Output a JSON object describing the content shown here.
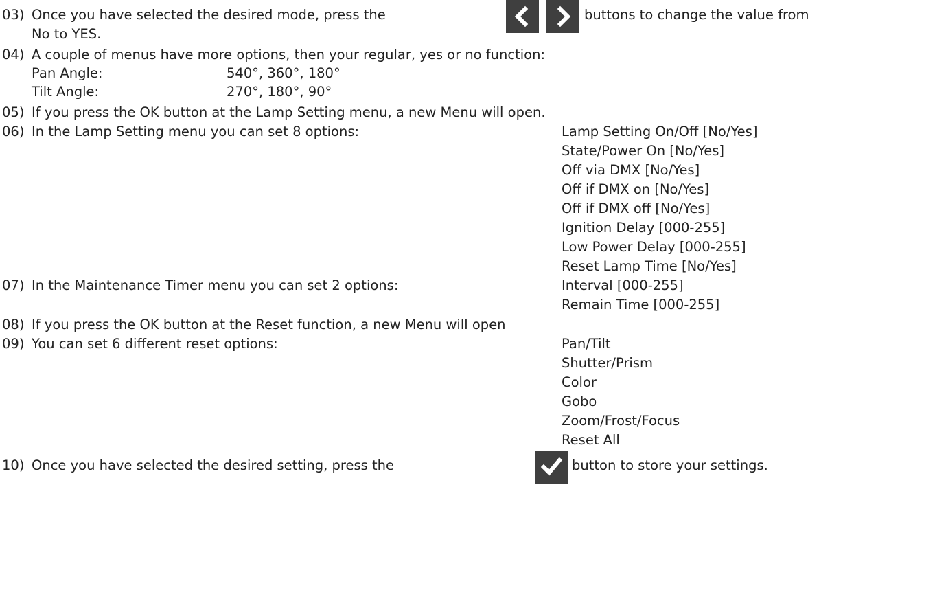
{
  "steps": [
    {
      "num": "03)",
      "text_before": "Once you have selected the desired mode, press the",
      "icons": [
        "chevron-left-icon",
        "chevron-right-icon"
      ],
      "text_after": "buttons to change the value from",
      "continuation": "No to YES."
    },
    {
      "num": "04)",
      "text": "A couple of menus have more options, then your regular, yes or no function:",
      "rows": [
        {
          "label": "Pan Angle:",
          "value": "540°, 360°, 180°"
        },
        {
          "label": "Tilt Angle:",
          "value": "270°, 180°, 90°"
        }
      ]
    },
    {
      "num": "05)",
      "text": "If you press the OK button at the Lamp Setting menu, a new Menu will open."
    },
    {
      "num": "06)",
      "text": "In the Lamp Setting menu you can set 8 options:",
      "options": [
        "Lamp Setting On/Off [No/Yes]",
        "State/Power On [No/Yes]",
        "Off via DMX [No/Yes]",
        "Off if DMX on [No/Yes]",
        "Off if DMX off [No/Yes]",
        "Ignition Delay [000-255]",
        "Low Power Delay [000-255]",
        "Reset Lamp Time [No/Yes]"
      ]
    },
    {
      "num": "07)",
      "text": "In the Maintenance Timer menu you can set 2 options:",
      "options": [
        "Interval [000-255]",
        "Remain Time [000-255]"
      ]
    },
    {
      "num": "08)",
      "text": "If you press the OK button at the Reset function, a new Menu will open"
    },
    {
      "num": "09)",
      "text": "You can set 6 different reset options:",
      "options": [
        "Pan/Tilt",
        "Shutter/Prism",
        "Color",
        "Gobo",
        "Zoom/Frost/Focus",
        "Reset All"
      ]
    },
    {
      "num": "10)",
      "text_before": "Once you have selected the desired setting, press the",
      "icons": [
        "checkmark-icon"
      ],
      "text_after": "button to store your settings."
    }
  ],
  "colors": {
    "text": "#222222",
    "icon_background": "#3f3f3f",
    "icon_foreground": "#ffffff"
  }
}
